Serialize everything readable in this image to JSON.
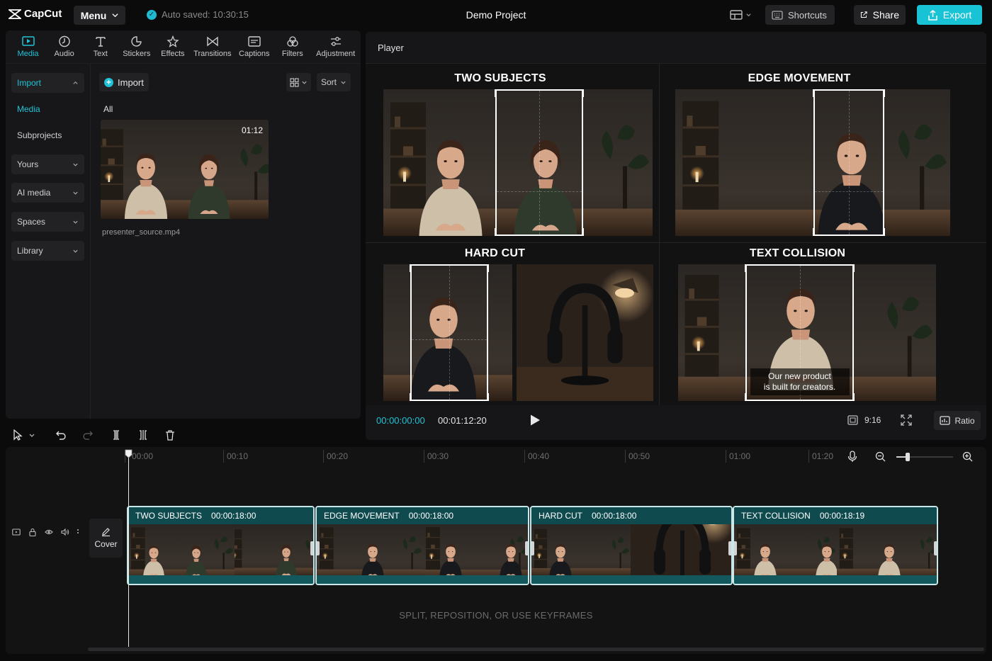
{
  "app": {
    "name": "CapCut"
  },
  "topbar": {
    "menu_label": "Menu",
    "autosave_text": "Auto saved: 10:30:15",
    "project_title": "Demo Project",
    "shortcuts_label": "Shortcuts",
    "share_label": "Share",
    "export_label": "Export"
  },
  "tool_tabs": [
    "Media",
    "Audio",
    "Text",
    "Stickers",
    "Effects",
    "Transitions",
    "Captions",
    "Filters",
    "Adjustment"
  ],
  "active_tab": "Media",
  "sidebar": {
    "import_label": "Import",
    "media_label": "Media",
    "subprojects_label": "Subprojects",
    "yours_label": "Yours",
    "ai_media_label": "AI media",
    "spaces_label": "Spaces",
    "library_label": "Library"
  },
  "media_panel": {
    "import_button": "Import",
    "sort_label": "Sort",
    "filter_label": "All",
    "items": [
      {
        "filename": "presenter_source.mp4",
        "duration": "01:12"
      }
    ]
  },
  "player": {
    "title": "Player",
    "quadrants": [
      "TWO SUBJECTS",
      "EDGE MOVEMENT",
      "HARD CUT",
      "TEXT COLLISION"
    ],
    "caption_text_line1": "Our new product",
    "caption_text_line2": "is built for creators.",
    "current_time": "00:00:00:00",
    "total_time": "00:01:12:20",
    "aspect_label": "9:16",
    "ratio_label": "Ratio"
  },
  "timeline": {
    "ruler_labels": [
      "00:00",
      "00:10",
      "00:20",
      "00:30",
      "00:40",
      "00:50",
      "01:00",
      "01:20"
    ],
    "cover_label": "Cover",
    "zoom_level": 0.2,
    "clips": [
      {
        "title": "TWO SUBJECTS",
        "duration": "00:00:18:00"
      },
      {
        "title": "EDGE MOVEMENT",
        "duration": "00:00:18:00"
      },
      {
        "title": "HARD CUT",
        "duration": "00:00:18:00"
      },
      {
        "title": "TEXT COLLISION",
        "duration": "00:00:18:19"
      }
    ],
    "hint_text": "SPLIT, REPOSITION, OR USE KEYFRAMES"
  },
  "colors": {
    "accent": "#17c3d5",
    "clip_fill": "#0f4a4f",
    "background": "#0b0b0c"
  }
}
